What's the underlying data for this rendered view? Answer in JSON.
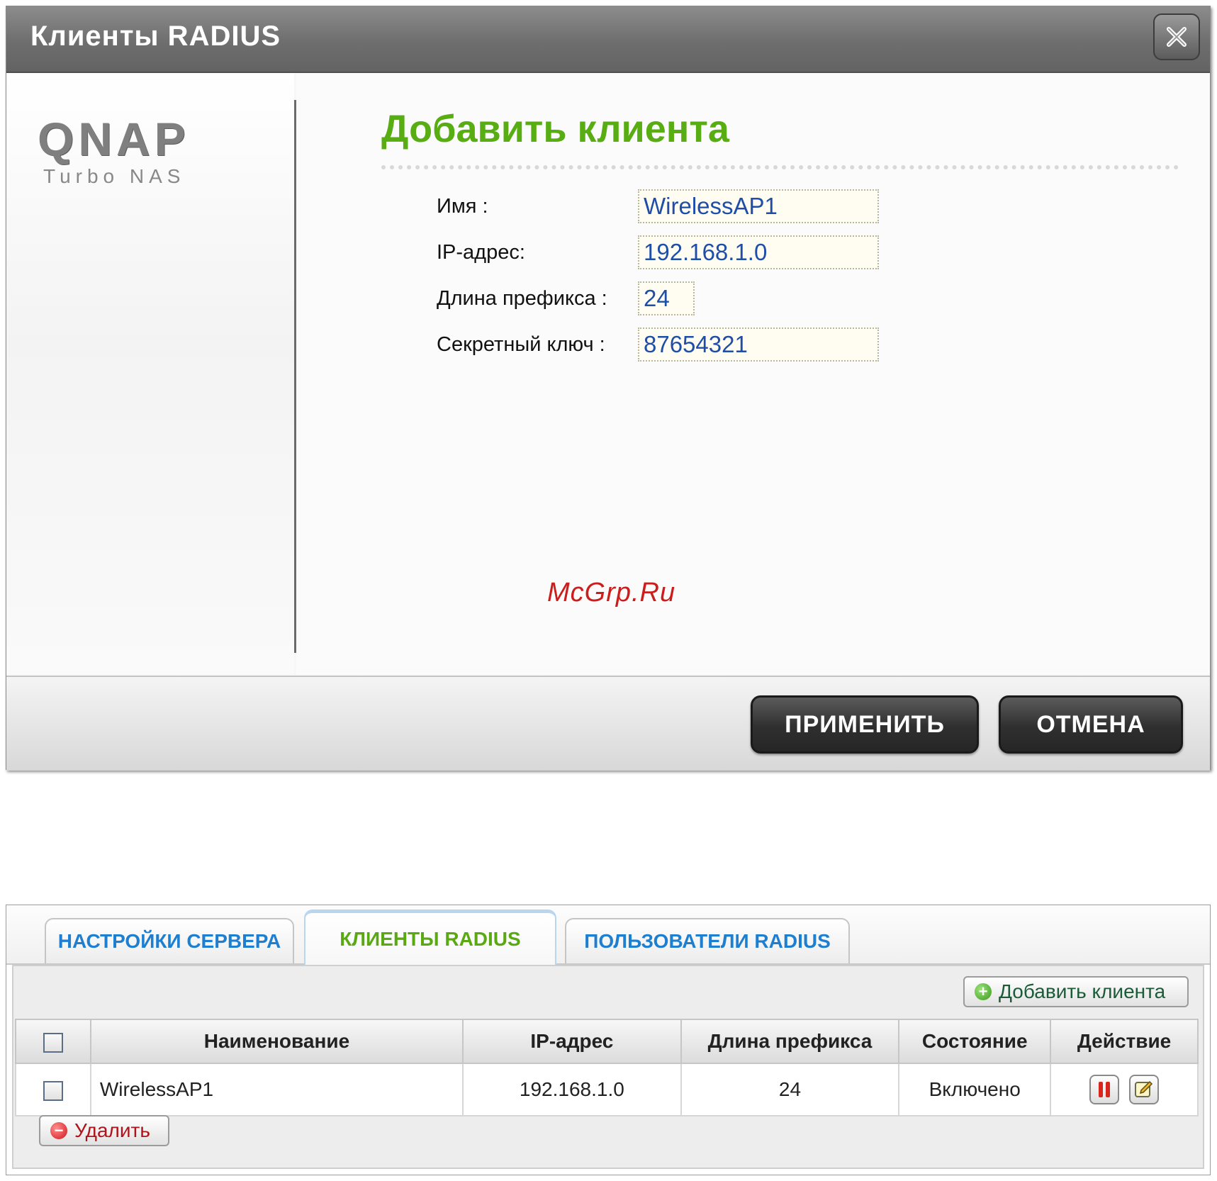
{
  "dialog": {
    "title": "Клиенты RADIUS",
    "logo_main": "QNAP",
    "logo_sub": "Turbo NAS",
    "heading": "Добавить клиента",
    "fields": {
      "name_label": "Имя :",
      "name_value": "WirelessAP1",
      "ip_label": "IP-адрес:",
      "ip_value": "192.168.1.0",
      "prefix_label": "Длина префикса :",
      "prefix_value": "24",
      "secret_label": "Секретный ключ :",
      "secret_value": "87654321"
    },
    "watermark": "McGrp.Ru",
    "apply_label": "ПРИМЕНИТЬ",
    "cancel_label": "ОТМЕНА"
  },
  "panel": {
    "tabs": [
      {
        "label": "НАСТРОЙКИ СЕРВЕРА",
        "active": false
      },
      {
        "label": "КЛИЕНТЫ RADIUS",
        "active": true
      },
      {
        "label": "ПОЛЬЗОВАТЕЛИ RADIUS",
        "active": false
      }
    ],
    "add_client_label": "Добавить клиента",
    "table": {
      "columns": [
        "Наименование",
        "IP-адрес",
        "Длина префикса",
        "Состояние",
        "Действие"
      ],
      "rows": [
        {
          "name": "WirelessAP1",
          "ip": "192.168.1.0",
          "prefix": "24",
          "status": "Включено",
          "actions": [
            "pause-icon",
            "edit-icon"
          ]
        }
      ]
    },
    "delete_label": "Удалить"
  },
  "colors": {
    "heading_green": "#58ad13",
    "tab_blue": "#1e7fd0",
    "input_text": "#1e4ea8",
    "watermark_red": "#cc1c1c"
  }
}
